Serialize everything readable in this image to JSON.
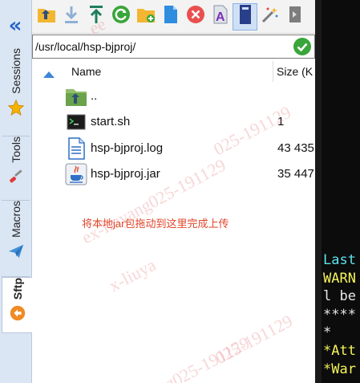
{
  "sidebar": {
    "collapse_glyph": "«",
    "tabs": [
      {
        "label": "Sessions",
        "icon": "star-icon"
      },
      {
        "label": "Tools",
        "icon": "screwdriver-icon"
      },
      {
        "label": "Macros",
        "icon": "paper-plane-icon"
      },
      {
        "label": "Sftp",
        "icon": "sftp-icon"
      }
    ]
  },
  "toolbar": {
    "buttons": [
      "parent-directory-icon",
      "download-icon",
      "upload-icon",
      "refresh-icon",
      "new-folder-icon",
      "new-file-icon",
      "delete-icon",
      "rename-icon",
      "follow-terminal-icon",
      "magic-wand-icon",
      "overflow-icon"
    ]
  },
  "path": {
    "value": "/usr/local/hsp-bjproj/"
  },
  "filelist": {
    "columns": {
      "name": "Name",
      "size": "Size (K"
    },
    "rows": [
      {
        "name": "..",
        "size": "",
        "icon": "parent-folder-icon"
      },
      {
        "name": "start.sh",
        "size": "1",
        "icon": "terminal-script-icon"
      },
      {
        "name": "hsp-bjproj.log",
        "size": "43 435",
        "icon": "text-file-icon"
      },
      {
        "name": "hsp-bjproj.jar",
        "size": "35 447",
        "icon": "java-jar-icon"
      }
    ],
    "drop_hint": "将本地jar包拖动到这里完成上传"
  },
  "watermarks": [
    "ee",
    "025-191129",
    "ex-liuyang025-191129",
    "x-liuya",
    "025-191129",
    "g025-191129"
  ],
  "terminal": {
    "lines": [
      {
        "text": "Last",
        "color": "#5fe3f0"
      },
      {
        "text": "WARN",
        "color": "#f4f45a"
      },
      {
        "text": "l be",
        "color": "#e8e8e8"
      },
      {
        "text": "****",
        "color": "#e8e8e8"
      },
      {
        "text": "*",
        "color": "#e8e8e8"
      },
      {
        "text": "*Att",
        "color": "#f4f45a"
      },
      {
        "text": "*War",
        "color": "#f4f45a"
      }
    ]
  },
  "colors": {
    "accent": "#2a63c7",
    "ok_green": "#3aa53a",
    "hint_red": "#e0452a"
  }
}
